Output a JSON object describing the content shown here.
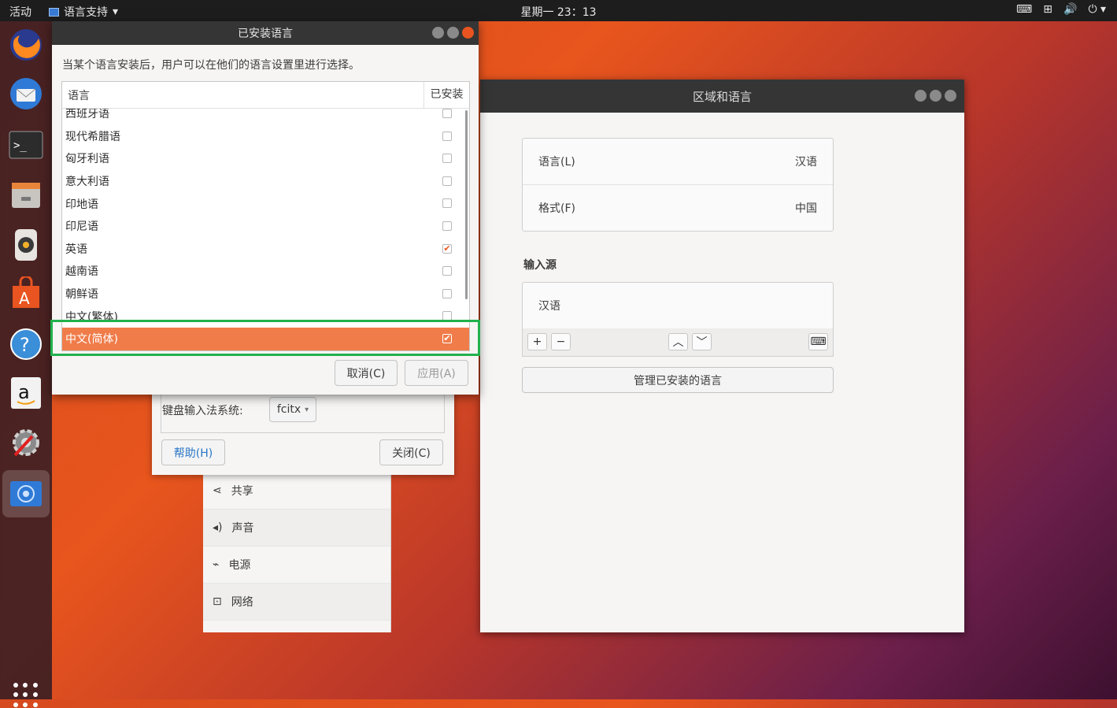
{
  "topbar": {
    "activities": "活动",
    "app_name": "语言支持",
    "clock": "星期一 23：13"
  },
  "dock": {
    "items": [
      "firefox-icon",
      "thunderbird-icon",
      "terminal-icon",
      "files-icon",
      "rhythmbox-icon",
      "software-icon",
      "help-icon",
      "amazon-icon",
      "settings-icon",
      "language-support-icon"
    ]
  },
  "region_window": {
    "title": "区域和语言",
    "language_label": "语言(L)",
    "language_value": "汉语",
    "format_label": "格式(F)",
    "format_value": "中国",
    "input_sources_title": "输入源",
    "input_source_item": "汉语",
    "manage_button": "管理已安装的语言"
  },
  "settings_sidebar": {
    "items": [
      {
        "label": "共享",
        "icon": "share-icon"
      },
      {
        "label": "声音",
        "icon": "sound-icon"
      },
      {
        "label": "电源",
        "icon": "power-icon"
      },
      {
        "label": "网络",
        "icon": "network-icon"
      }
    ]
  },
  "language_support": {
    "ime_label": "键盘输入法系统:",
    "ime_value": "fcitx",
    "help_button": "帮助(H)",
    "close_button": "关闭(C)"
  },
  "installed_dialog": {
    "title": "已安装语言",
    "description": "当某个语言安装后，用户可以在他们的语言设置里进行选择。",
    "col_language": "语言",
    "col_installed": "已安装",
    "rows": [
      {
        "name": "西班牙语",
        "installed": false
      },
      {
        "name": "现代希腊语",
        "installed": false
      },
      {
        "name": "匈牙利语",
        "installed": false
      },
      {
        "name": "意大利语",
        "installed": false
      },
      {
        "name": "印地语",
        "installed": false
      },
      {
        "name": "印尼语",
        "installed": false
      },
      {
        "name": "英语",
        "installed": true
      },
      {
        "name": "越南语",
        "installed": false
      },
      {
        "name": "朝鲜语",
        "installed": false
      },
      {
        "name": "中文(繁体)",
        "installed": false
      },
      {
        "name": "中文(简体)",
        "installed": true,
        "selected": true
      }
    ],
    "cancel_button": "取消(C)",
    "apply_button": "应用(A)"
  },
  "colors": {
    "accent": "#e95420",
    "selection": "#f07c4a",
    "highlight_box": "#22b14c"
  }
}
